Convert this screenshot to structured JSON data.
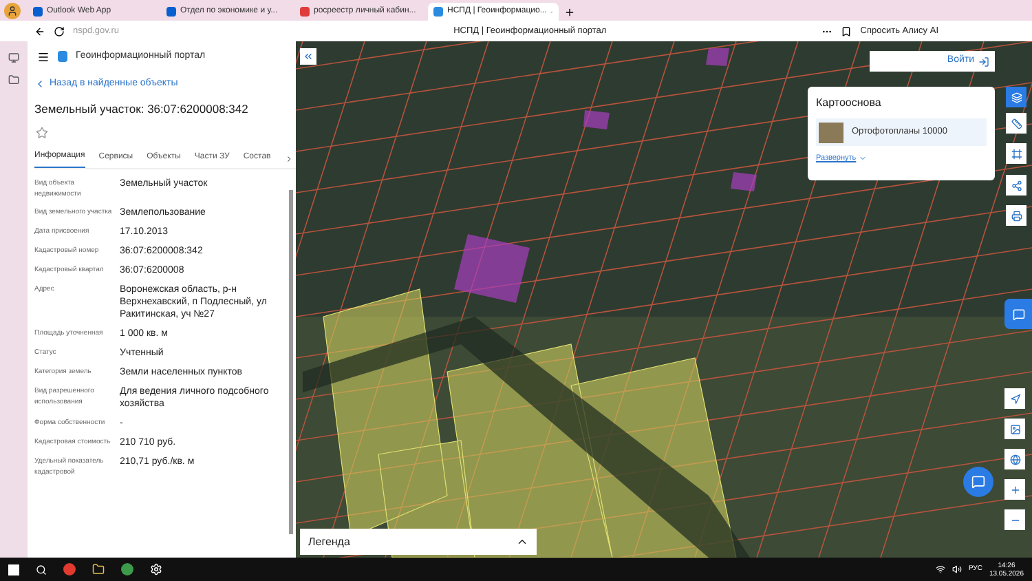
{
  "browser": {
    "tabs": [
      {
        "title": "Outlook Web App",
        "selected": false
      },
      {
        "title": "Отдел по экономике и у...",
        "selected": false
      },
      {
        "title": "росреестр личный кабин...",
        "selected": false
      },
      {
        "title": "НСПД | Геоинформацио...",
        "selected": true
      }
    ],
    "address": "nspd.gov.ru",
    "page_title": "НСПД | Геоинформационный портал",
    "assistant": "Спросить Алису AI"
  },
  "panel": {
    "portal": "Геоинформационный портал",
    "back": "Назад в найденные объекты",
    "title": "Земельный участок: 36:07:6200008:342",
    "tabs": [
      {
        "label": "Информация",
        "selected": true
      },
      {
        "label": "Сервисы",
        "selected": false
      },
      {
        "label": "Объекты",
        "selected": false
      },
      {
        "label": "Части ЗУ",
        "selected": false
      },
      {
        "label": "Состав",
        "selected": false
      }
    ],
    "fields": [
      {
        "label": "Вид объекта недвижимости",
        "value": "Земельный участок"
      },
      {
        "label": "Вид земельного участка",
        "value": "Землепользование"
      },
      {
        "label": "Дата присвоения",
        "value": "17.10.2013"
      },
      {
        "label": "Кадастровый номер",
        "value": "36:07:6200008:342"
      },
      {
        "label": "Кадастровый квартал",
        "value": "36:07:6200008"
      },
      {
        "label": "Адрес",
        "value": "Воронежская область, р-н Верхнехавский, п Подлесный, ул Ракитинская, уч №27"
      },
      {
        "label": "Площадь уточненная",
        "value": "1 000 кв. м"
      },
      {
        "label": "Статус",
        "value": "Учтенный"
      },
      {
        "label": "Категория земель",
        "value": "Земли населенных пунктов"
      },
      {
        "label": "Вид разрешенного использования",
        "value": "Для ведения личного подсобного хозяйства"
      },
      {
        "label": "Форма собственности",
        "value": "-"
      },
      {
        "label": "Кадастровая стоимость",
        "value": "210 710 руб."
      },
      {
        "label": "Удельный показатель кадастровой",
        "value": "210,71 руб./кв. м"
      }
    ]
  },
  "map": {
    "login": "Войти",
    "basemap": {
      "title": "Картооснова",
      "layer": "Ортофотопланы 10000",
      "expand": "Развернуть"
    },
    "legend": "Легенда"
  },
  "taskbar": {
    "language": "РУС",
    "time": "14:26",
    "date": "13.05.2026"
  }
}
